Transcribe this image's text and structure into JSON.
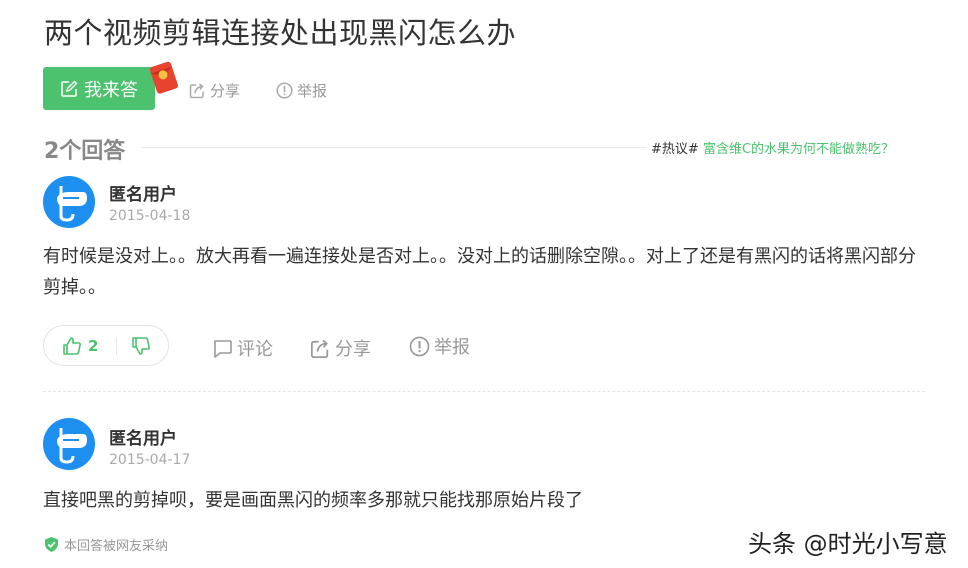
{
  "question": {
    "title": "两个视频剪辑连接处出现黑闪怎么办",
    "answer_button": "我来答",
    "share_label": "分享",
    "report_label": "举报"
  },
  "answers_header": {
    "count_label": "2个回答",
    "hot_tag": "#热议#",
    "hot_link": "富含维C的水果为何不能做熟吃？"
  },
  "answers": [
    {
      "user": "匿名用户",
      "date": "2015-04-18",
      "content": "有时候是没对上。。放大再看一遍连接处是否对上。。没对上的话删除空隙。。对上了还是有黑闪的话将黑闪部分剪掉。。",
      "likes": "2",
      "comment_label": "评论",
      "share_label": "分享",
      "report_label": "举报"
    },
    {
      "user": "匿名用户",
      "date": "2015-04-17",
      "content": "直接吧黑的剪掉呗，要是画面黑闪的频率多那就只能找那原始片段了",
      "adopted_label": "本回答被网友采纳"
    }
  ],
  "watermark": "头条 @时光小写意",
  "colors": {
    "accent_green": "#4cc16e",
    "avatar_blue": "#1d8ff0",
    "muted_text": "#999999"
  }
}
